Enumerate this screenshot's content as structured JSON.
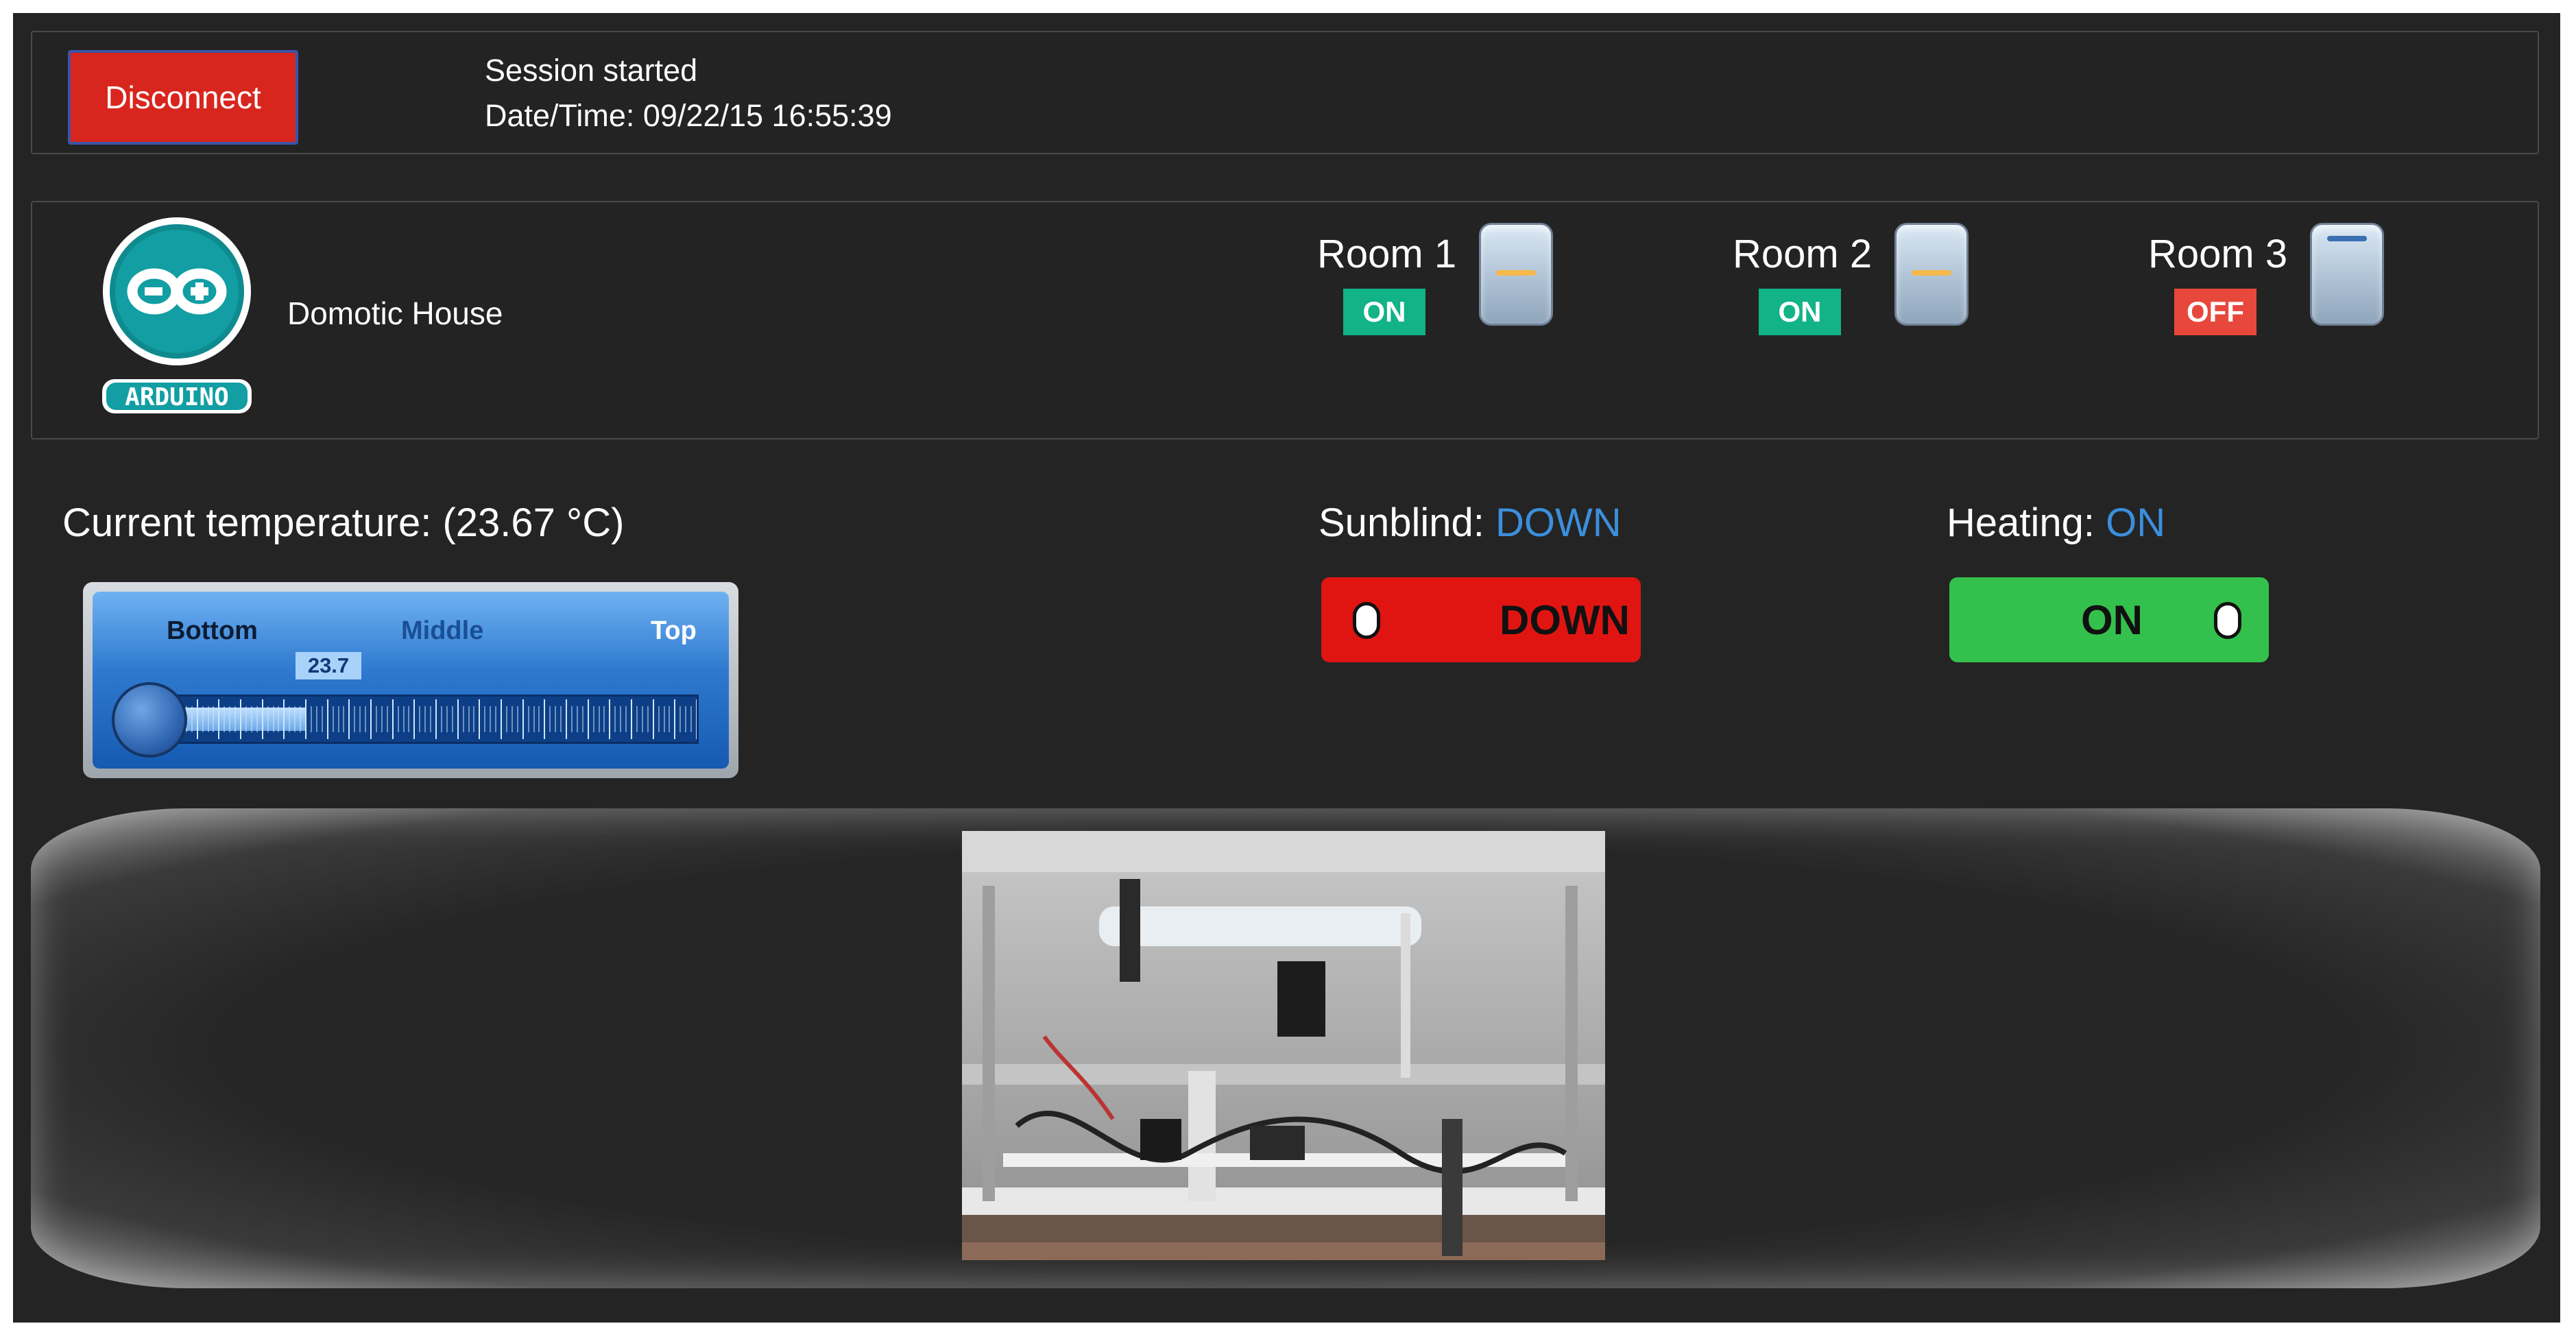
{
  "session": {
    "disconnect_label": "Disconnect",
    "status": "Session started",
    "datetime": "Date/Time: 09/22/15 16:55:39"
  },
  "house": {
    "logo_text": "ARDUINO",
    "name": "Domotic House"
  },
  "rooms": [
    {
      "name": "Room 1",
      "state": "ON"
    },
    {
      "name": "Room 2",
      "state": "ON"
    },
    {
      "name": "Room 3",
      "state": "OFF"
    }
  ],
  "temperature": {
    "title": "Current temperature: (23.67 °C)",
    "gauge_value": "23.7",
    "gauge_labels": {
      "bottom": "Bottom",
      "middle": "Middle",
      "top": "Top"
    },
    "gauge_fill_fraction": 0.25
  },
  "sunblind": {
    "label": "Sunblind:",
    "value": "DOWN",
    "toggle_text": "DOWN"
  },
  "heating": {
    "label": "Heating:",
    "value": "ON",
    "toggle_text": "ON"
  },
  "colors": {
    "background": "#242424",
    "disconnect": "#d8261f",
    "badge_on": "#12b386",
    "badge_off": "#e8473c",
    "status_value": "#3b8fdc",
    "toggle_down": "#e01512",
    "toggle_on": "#34c04c",
    "switch_on_line": "#f5b84a",
    "switch_off_line": "#3b6fb5"
  },
  "icons": {
    "logo": "arduino-logo-icon",
    "room_switch": "light-switch-icon",
    "thermometer": "thermometer-gauge-icon"
  }
}
